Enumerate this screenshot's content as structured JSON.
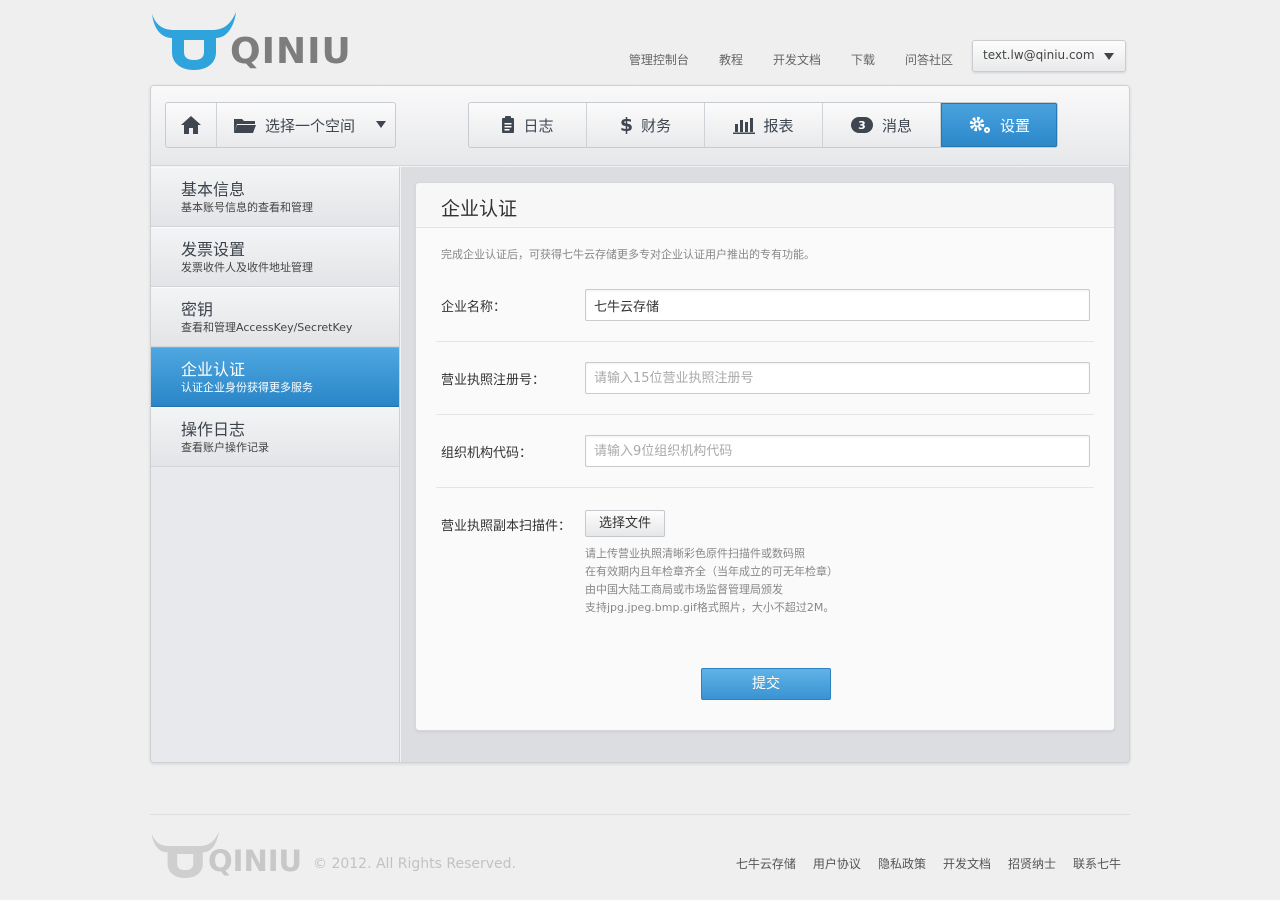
{
  "brand": {
    "name": "QINIU",
    "accent": "#2a85c7"
  },
  "top_nav": [
    {
      "label": "管理控制台"
    },
    {
      "label": "教程"
    },
    {
      "label": "开发文档"
    },
    {
      "label": "下载"
    },
    {
      "label": "问答社区"
    }
  ],
  "user_menu": {
    "email": "text.lw@qiniu.com",
    "icon": "chevron-down-icon"
  },
  "toolbar": {
    "home_icon": "home-icon",
    "space_select": {
      "label": "选择一个空间",
      "icon": "folder-icon"
    },
    "tabs": [
      {
        "label": "日志",
        "icon": "clipboard-icon"
      },
      {
        "label": "财务",
        "icon": "dollar-icon"
      },
      {
        "label": "报表",
        "icon": "bar-chart-icon"
      },
      {
        "label": "消息",
        "icon": "message-icon",
        "badge": "3"
      },
      {
        "label": "设置",
        "icon": "gears-icon",
        "active": true
      }
    ]
  },
  "sidebar": {
    "items": [
      {
        "title": "基本信息",
        "desc": "基本账号信息的查看和管理"
      },
      {
        "title": "发票设置",
        "desc": "发票收件人及收件地址管理"
      },
      {
        "title": "密钥",
        "desc": "查看和管理AccessKey/SecretKey"
      },
      {
        "title": "企业认证",
        "desc": "认证企业身份获得更多服务",
        "active": true
      },
      {
        "title": "操作日志",
        "desc": "查看账户操作记录"
      }
    ]
  },
  "panel": {
    "title": "企业认证",
    "intro": "完成企业认证后，可获得七牛云存储更多专对企业认证用户推出的专有功能。",
    "company_name": {
      "label": "企业名称：",
      "value": "七牛云存储"
    },
    "license_no": {
      "label": "营业执照注册号：",
      "placeholder": "请输入15位营业执照注册号"
    },
    "org_code": {
      "label": "组织机构代码：",
      "placeholder": "请输入9位组织机构代码"
    },
    "scan": {
      "label": "营业执照副本扫描件：",
      "button": "选择文件",
      "notes": [
        "请上传营业执照清晰彩色原件扫描件或数码照",
        "在有效期内且年检章齐全（当年成立的可无年检章）",
        "由中国大陆工商局或市场监督管理局颁发",
        "支持jpg.jpeg.bmp.gif格式照片，大小不超过2M。"
      ]
    },
    "submit": "提交"
  },
  "footer": {
    "logo": "QINIU",
    "copyright": "© 2012. All Rights Reserved.",
    "links": [
      {
        "label": "七牛云存储"
      },
      {
        "label": "用户协议"
      },
      {
        "label": "隐私政策"
      },
      {
        "label": "开发文档"
      },
      {
        "label": "招贤纳士"
      },
      {
        "label": "联系七牛"
      }
    ]
  }
}
